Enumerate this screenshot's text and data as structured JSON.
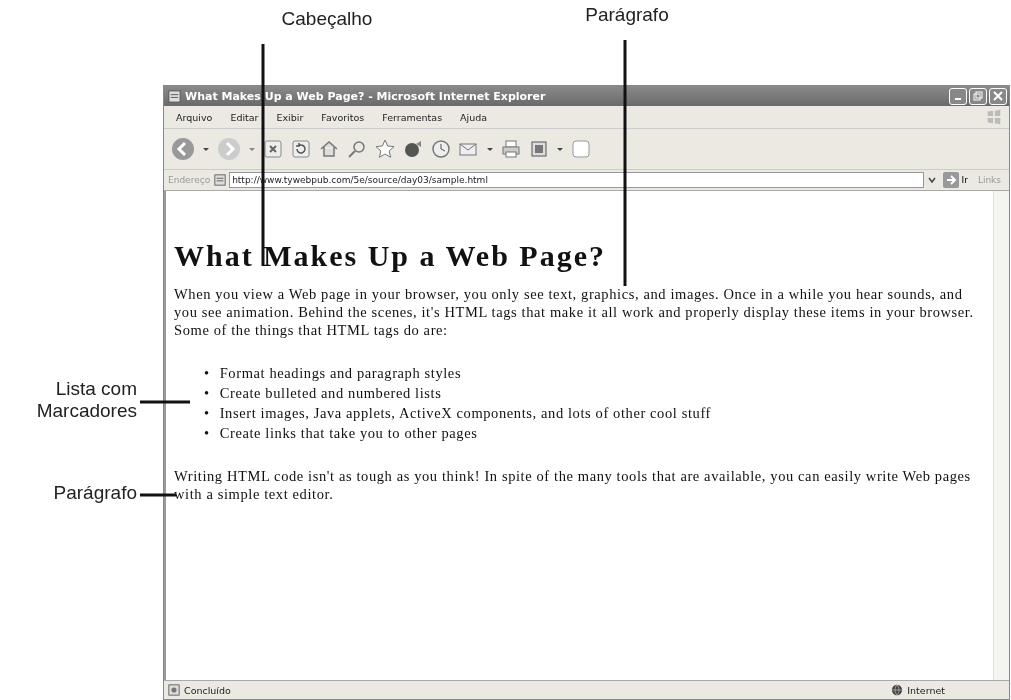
{
  "annotations": [
    {
      "label": "Cabeçalho"
    },
    {
      "label": "Parágrafo"
    },
    {
      "label": "Lista com Marcadores"
    },
    {
      "label": "Parágrafo"
    }
  ],
  "window": {
    "title": "What Makes Up a Web Page? - Microsoft Internet Explorer",
    "menu": [
      "Arquivo",
      "Editar",
      "Exibir",
      "Favoritos",
      "Ferramentas",
      "Ajuda"
    ],
    "address": {
      "label": "Endereço",
      "value": "http://www.tywebpub.com/5e/source/day03/sample.html",
      "go": "Ir",
      "links": "Links"
    },
    "page": {
      "heading": "What Makes Up a Web Page?",
      "intro": "When you view a Web page in your browser, you only see text, graphics, and images. Once in a while you hear sounds, and you see animation. Behind the scenes, it's HTML tags that make it all work and properly display these items in your browser. Some of the things that HTML tags do are:",
      "list": [
        {
          "bullet": "•",
          "text": "Format headings and paragraph styles"
        },
        {
          "bullet": "•",
          "text": "Create bulleted and numbered lists"
        },
        {
          "bullet": "•",
          "text": "Insert images, Java applets, ActiveX components, and lots of other cool stuff"
        },
        {
          "bullet": "•",
          "text": "Create links that take you to other pages"
        }
      ],
      "closing": "Writing HTML code isn't as tough as you think! In spite of the many tools that are available, you can easily write Web pages with a simple text editor."
    },
    "status": {
      "text": "Concluído",
      "zone": "Internet"
    }
  }
}
